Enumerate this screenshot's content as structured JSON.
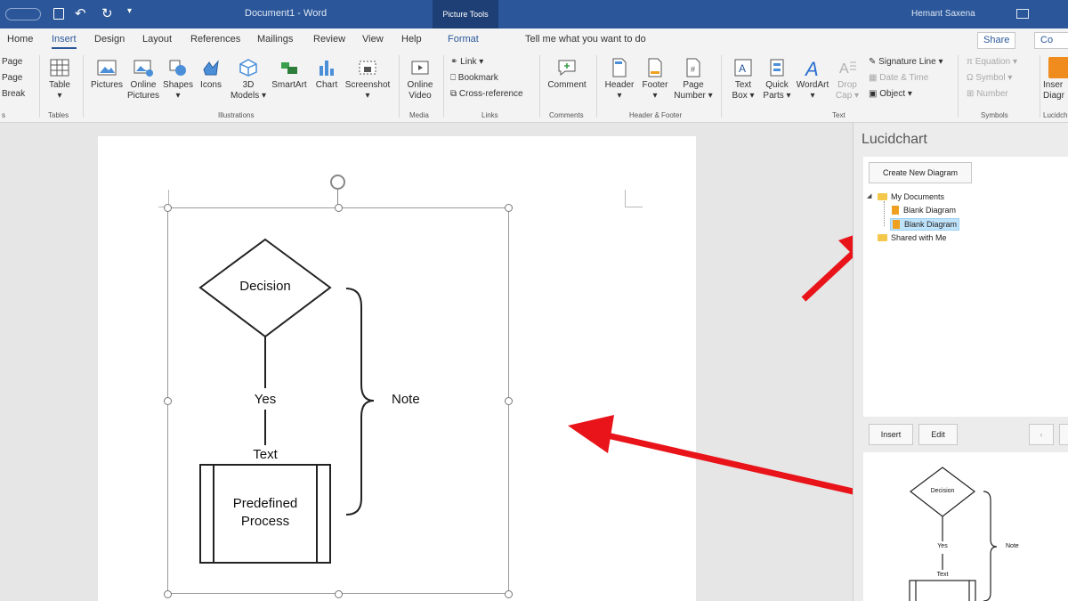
{
  "titlebar": {
    "document_title": "Document1 - Word",
    "context_tab": "Picture Tools",
    "user_name": "Hemant Saxena"
  },
  "tabs": [
    "Home",
    "Insert",
    "Design",
    "Layout",
    "References",
    "Mailings",
    "Review",
    "View",
    "Help",
    "Format"
  ],
  "active_tab": "Insert",
  "tell_me": "Tell me what you want to do",
  "share_label": "Share",
  "comments_label": "Co",
  "ribbon": {
    "pages": [
      "Page",
      "Page",
      "Break"
    ],
    "table": "Table",
    "pictures": "Pictures",
    "online_pictures": "Online\nPictures",
    "shapes": "Shapes",
    "icons": "Icons",
    "models_3d": "3D\nModels",
    "smartart": "SmartArt",
    "chart": "Chart",
    "screenshot": "Screenshot",
    "online_video": "Online\nVideo",
    "link": "Link",
    "bookmark": "Bookmark",
    "cross_reference": "Cross-reference",
    "comment": "Comment",
    "header": "Header",
    "footer": "Footer",
    "page_number": "Page\nNumber",
    "text_box": "Text\nBox",
    "quick_parts": "Quick\nParts",
    "wordart": "WordArt",
    "drop_cap": "Drop\nCap",
    "signature_line": "Signature Line",
    "date_time": "Date & Time",
    "object": "Object",
    "equation": "Equation",
    "symbol": "Symbol",
    "number": "Number",
    "insert_diagram": "Inser\nDiagr",
    "groups": {
      "pages_partial": "s",
      "tables": "Tables",
      "illustrations": "Illustrations",
      "media": "Media",
      "links": "Links",
      "comments": "Comments",
      "header_footer": "Header & Footer",
      "text": "Text",
      "symbols": "Symbols",
      "lucidchart": "Lucidch"
    }
  },
  "diagram": {
    "decision": "Decision",
    "yes": "Yes",
    "text": "Text",
    "process": "Predefined\nProcess",
    "note": "Note"
  },
  "panel": {
    "title": "Lucidchart",
    "create_button": "Create New Diagram",
    "tree": {
      "my_documents": "My Documents",
      "items": [
        "Blank Diagram",
        "Blank Diagram"
      ],
      "shared": "Shared with Me"
    },
    "insert_button": "Insert",
    "edit_button": "Edit",
    "prev_button": "‹",
    "preview": {
      "decision": "Decision",
      "yes": "Yes",
      "text": "Text",
      "note": "Note"
    }
  },
  "colors": {
    "title_bar": "#2b579a",
    "arrow": "#e8141a",
    "selection": "#bfe3fb"
  }
}
